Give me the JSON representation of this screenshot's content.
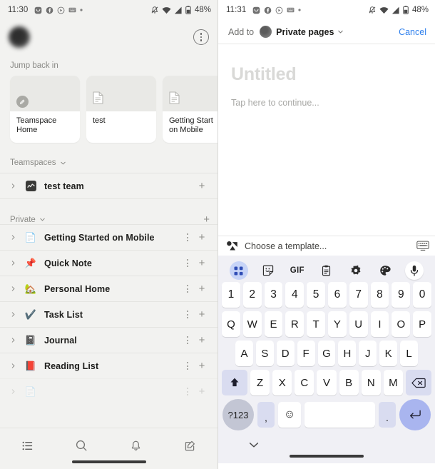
{
  "left": {
    "status_bar": {
      "time": "11:30",
      "battery_pct": "48%",
      "icons": [
        "messenger-icon",
        "facebook-icon",
        "play-circle-icon",
        "keyboard-icon",
        "dot-icon"
      ],
      "right_icons": [
        "bell-muted-icon",
        "wifi-icon",
        "signal-icon",
        "battery-icon"
      ]
    },
    "account": {
      "more_icon": "more-vertical-icon"
    },
    "jump_back_in": {
      "label": "Jump back in",
      "cards": [
        {
          "title": "Teamspace\nHome",
          "icon": "teamspace-circle-icon"
        },
        {
          "title": "test",
          "icon": "page-icon"
        },
        {
          "title": "Getting Start\non Mobile",
          "icon": "page-icon"
        }
      ]
    },
    "teamspaces": {
      "label": "Teamspaces",
      "items": [
        {
          "label": "test team",
          "icon": "teamspace-square-icon",
          "plus": "+"
        }
      ]
    },
    "private": {
      "label": "Private",
      "add_label": "+",
      "items": [
        {
          "label": "Getting Started on Mobile",
          "emoji": "📄",
          "icon_name": "document-icon"
        },
        {
          "label": "Quick Note",
          "emoji": "📌",
          "icon_name": "pushpin-icon"
        },
        {
          "label": "Personal Home",
          "emoji": "🏡",
          "icon_name": "house-garden-icon"
        },
        {
          "label": "Task List",
          "emoji": "✔️",
          "icon_name": "check-mark-icon"
        },
        {
          "label": "Journal",
          "emoji": "📓",
          "icon_name": "notebook-icon"
        },
        {
          "label": "Reading List",
          "emoji": "📕",
          "icon_name": "closed-book-icon"
        }
      ]
    },
    "bottom_nav": [
      {
        "name": "nav-list",
        "icon": "list-icon"
      },
      {
        "name": "nav-search",
        "icon": "search-icon"
      },
      {
        "name": "nav-inbox",
        "icon": "bell-icon"
      },
      {
        "name": "nav-compose",
        "icon": "compose-icon"
      }
    ]
  },
  "right": {
    "status_bar": {
      "time": "11:31",
      "battery_pct": "48%"
    },
    "add_bar": {
      "add_to_label": "Add to",
      "destination": "Private pages",
      "cancel_label": "Cancel",
      "chevron_icon": "chevron-down-icon"
    },
    "editor": {
      "title_placeholder": "Untitled",
      "body_placeholder": "Tap here to continue..."
    },
    "template_bar": {
      "lens_icon": "google-lens-icon",
      "placeholder": "Choose a template...",
      "keyboard_icon": "keyboard-icon"
    },
    "keyboard": {
      "tools": [
        {
          "name": "grid-icon",
          "label": "",
          "active": true
        },
        {
          "name": "sticker-icon",
          "label": "",
          "active": false
        },
        {
          "name": "gif-icon",
          "label": "GIF",
          "active": false
        },
        {
          "name": "clipboard-icon",
          "label": "",
          "active": false
        },
        {
          "name": "gear-icon",
          "label": "",
          "active": false
        },
        {
          "name": "palette-icon",
          "label": "",
          "active": false
        },
        {
          "name": "mic-icon",
          "label": "",
          "active": false
        }
      ],
      "row_numbers": [
        "1",
        "2",
        "3",
        "4",
        "5",
        "6",
        "7",
        "8",
        "9",
        "0"
      ],
      "row_top": [
        "Q",
        "W",
        "E",
        "R",
        "T",
        "Y",
        "U",
        "I",
        "O",
        "P"
      ],
      "row_mid": [
        "A",
        "S",
        "D",
        "F",
        "G",
        "H",
        "J",
        "K",
        "L"
      ],
      "row_bot": [
        "Z",
        "X",
        "C",
        "V",
        "B",
        "N",
        "M"
      ],
      "shift_icon": "shift-icon",
      "backspace_icon": "backspace-icon",
      "sym_key": "?123",
      "comma_key": ",",
      "emoji_key": "☺",
      "space_key": "",
      "period_key": ".",
      "enter_icon": "enter-icon",
      "dismiss_icon": "chevron-down-icon"
    }
  },
  "colors": {
    "left_bg": "#f2f2f0",
    "accent_blue": "#2f80ed",
    "keyboard_bg": "#f0f0f5",
    "key_fn_bg": "#d9dcf0",
    "enter_bg": "#a9b5ef",
    "sym_bg": "#c3c6d4",
    "tool_active_bg": "#c7d4f7"
  }
}
